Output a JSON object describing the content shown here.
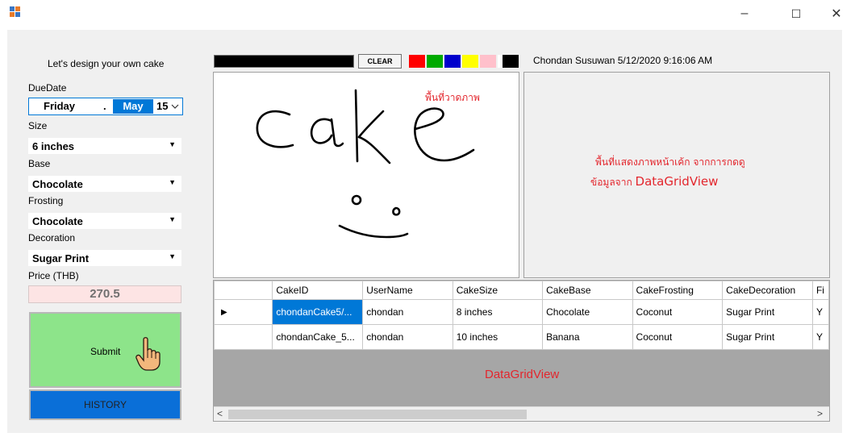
{
  "window": {
    "icon": "app-icon",
    "controls": [
      "–",
      "☐",
      "✕"
    ]
  },
  "form": {
    "heading": "Let's design your own cake",
    "due_date": {
      "label": "DueDate",
      "day": "Friday",
      "separator": ".",
      "month": "May",
      "date": "15",
      "dropdown_icon": "chevron-down-icon"
    },
    "size": {
      "label": "Size",
      "value": "6 inches"
    },
    "base": {
      "label": "Base",
      "value": "Chocolate"
    },
    "frosting": {
      "label": "Frosting",
      "value": "Chocolate"
    },
    "decoration": {
      "label": "Decoration",
      "value": "Sugar Print"
    },
    "price": {
      "label": "Price (THB)",
      "value": "270.5"
    },
    "submit_label": "Submit",
    "history_label": "HISTORY"
  },
  "toolbar": {
    "clear_label": "CLEAR",
    "current_color": "#000000",
    "palette": [
      "#ff0000",
      "#00aa00",
      "#0000cc",
      "#ffff00",
      "#ffc0cb",
      "#ffffff",
      "#000000"
    ],
    "user_info": "Chondan Susuwan 5/12/2020 9:16:06 AM"
  },
  "canvas": {
    "annotation": "พื้นที่วาดภาพ"
  },
  "preview": {
    "annotation_line1": "พื้นที่แสดงภาพหน้าเค้ก จากการกดดู",
    "annotation_line2_prefix": "ข้อมูลจาก ",
    "annotation_line2_highlight": "DataGridView"
  },
  "grid": {
    "columns": [
      "CakeID",
      "UserName",
      "CakeSize",
      "CakeBase",
      "CakeFrosting",
      "CakeDecoration",
      "Fi"
    ],
    "rows": [
      [
        "chondanCake5/...",
        "chondan",
        "8 inches",
        "Chocolate",
        "Coconut",
        "Sugar Print",
        "Y"
      ],
      [
        "chondanCake_5...",
        "chondan",
        "10 inches",
        "Banana",
        "Coconut",
        "Sugar Print",
        "Y"
      ]
    ],
    "current_row_marker": "▶",
    "empty_area_label": "DataGridView",
    "scroll_left": "<",
    "scroll_right": ">"
  },
  "colors": {
    "accent_red": "#e3262d",
    "selection_blue": "#0078d7",
    "submit_green": "#8de48a",
    "history_blue": "#0a6fd8",
    "price_bg": "#fde4e4",
    "grid_empty": "#a6a6a6"
  }
}
